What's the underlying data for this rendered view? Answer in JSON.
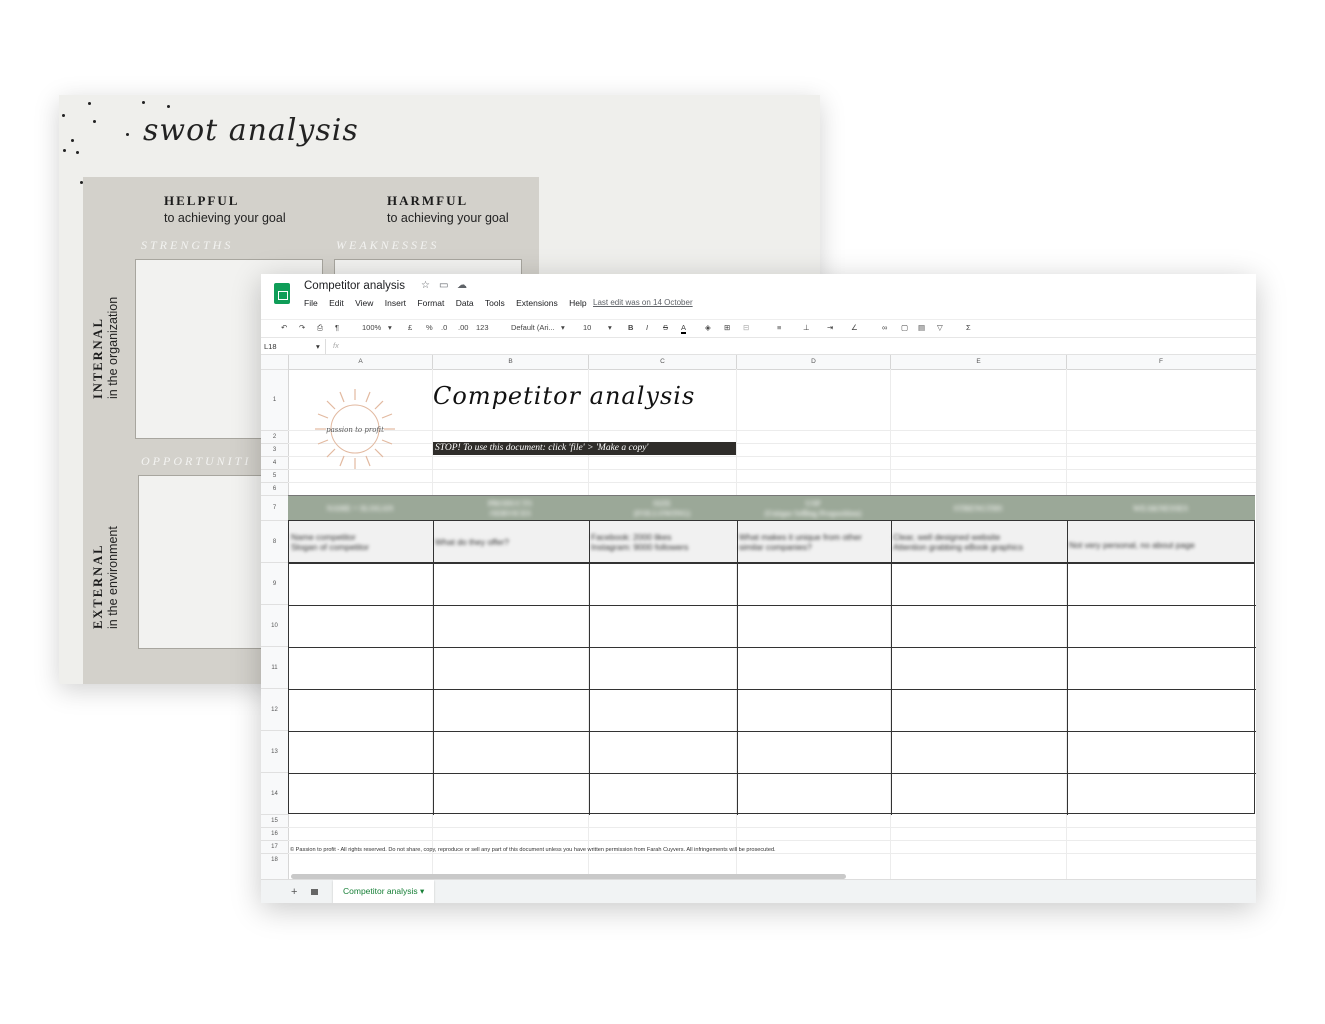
{
  "swot": {
    "title": "swot analysis",
    "helpful": {
      "heading": "HELPFUL",
      "sub": "to achieving your goal"
    },
    "harmful": {
      "heading": "HARMFUL",
      "sub": "to achieving your goal"
    },
    "strengths": "STRENGTHS",
    "weaknesses": "WEAKNESSES",
    "opportunities": "OPPORTUNITI",
    "internal": {
      "heading": "INTERNAL",
      "sub": "in the organization"
    },
    "external": {
      "heading": "EXTERNAL",
      "sub": "in the environment"
    }
  },
  "sheet": {
    "doc_title": "Competitor analysis",
    "menu": [
      "File",
      "Edit",
      "View",
      "Insert",
      "Format",
      "Data",
      "Tools",
      "Extensions",
      "Help"
    ],
    "last_edit": "Last edit was on 14 October",
    "toolbar": {
      "zoom": "100%",
      "currency": "£",
      "percent": "%",
      "dec_less": ".0",
      "dec_more": ".00",
      "format_more": "123",
      "font": "Default (Ari...",
      "font_size": "10",
      "bold": "B",
      "italic": "I",
      "strike": "S",
      "text_color": "A",
      "sum": "Σ"
    },
    "cell_ref": "L18",
    "fx": "fx",
    "columns": [
      "A",
      "B",
      "C",
      "D",
      "E",
      "F"
    ],
    "rows": [
      "1",
      "2",
      "3",
      "4",
      "5",
      "6",
      "7",
      "8",
      "9",
      "10",
      "11",
      "12",
      "13",
      "14",
      "15",
      "16",
      "17",
      "18"
    ],
    "logo_text": "passion to profit",
    "big_title": "Competitor analysis",
    "stop_text": "STOP! To use this document: click 'file' > 'Make a copy'",
    "headers": [
      {
        "line1": "NAME + SLOGAN",
        "line2": ""
      },
      {
        "line1": "PRODUCTS",
        "line2": "/SERVICES"
      },
      {
        "line1": "SIZE",
        "line2": "(FOLLOWING)"
      },
      {
        "line1": "USP",
        "line2": "(Unique Selling Proposition)"
      },
      {
        "line1": "STRENGTHS",
        "line2": ""
      },
      {
        "line1": "WEAKNESSES",
        "line2": ""
      }
    ],
    "example_row": [
      {
        "line1": "Name competitor",
        "line2": "Slogan of competitor"
      },
      {
        "line1": "What do they offer?",
        "line2": ""
      },
      {
        "line1": "Facebook: 2000 likes",
        "line2": "Instagram: 9000 followers"
      },
      {
        "line1": "What makes it unique from other",
        "line2": "similar companies?"
      },
      {
        "line1": "Clear, well designed website",
        "line2": "Attention grabbing eBook graphics"
      },
      {
        "line1": "Not very personal, no about page",
        "line2": ""
      }
    ],
    "copyright": "© Passion to profit - All rights reserved. Do not share, copy, reproduce or sell any part of this document unless you have written permission from Farah Cuyvers. All infringements will be prosecuted.",
    "tab_name": "Competitor analysis",
    "colors": {
      "header_green": "#9ba898",
      "stop_bar": "#2f2d2a",
      "tab_green": "#188038",
      "sun": "#e2b9a0"
    }
  }
}
